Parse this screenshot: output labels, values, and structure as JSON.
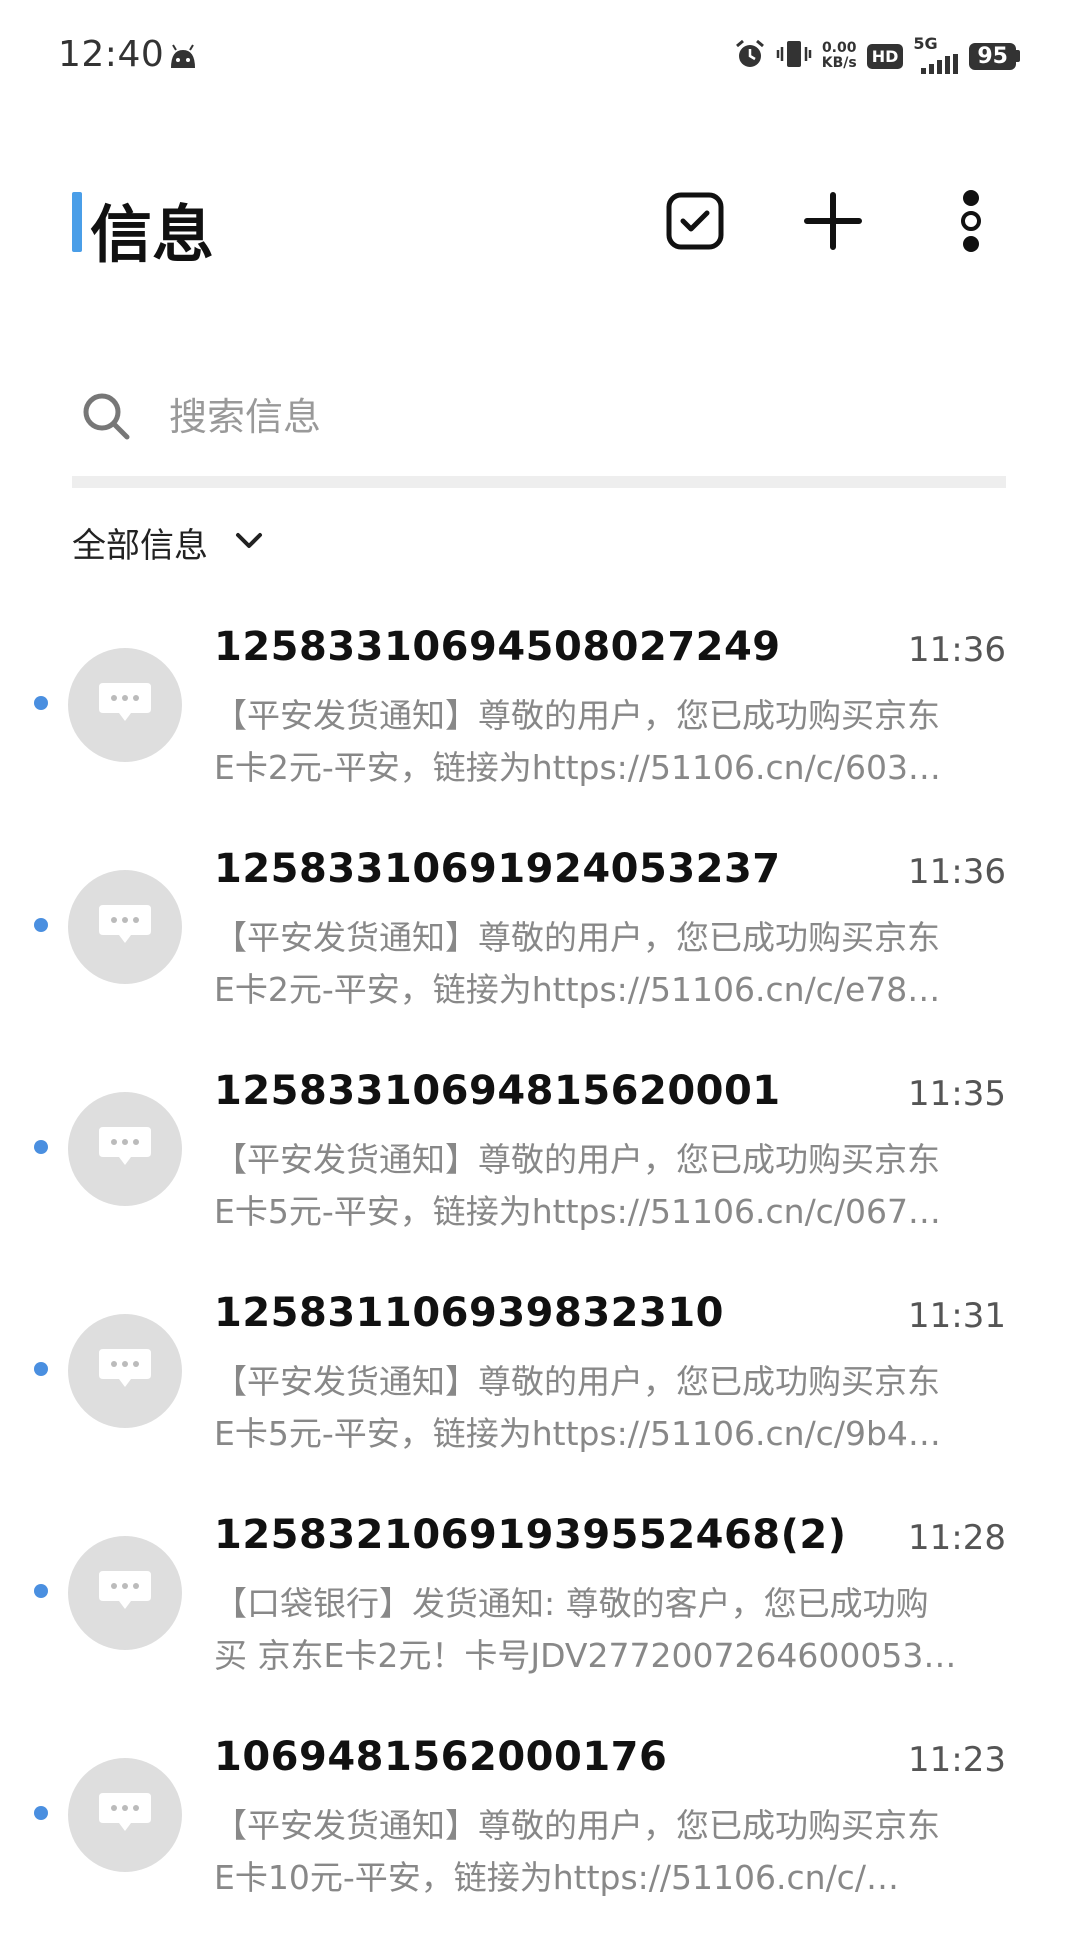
{
  "status_bar": {
    "time": "12:40",
    "netspeed_value": "0.00",
    "netspeed_unit": "KB/s",
    "hd": "HD",
    "network": "5G",
    "battery": "95"
  },
  "header": {
    "title": "信息"
  },
  "search": {
    "placeholder": "搜索信息"
  },
  "filter": {
    "label": "全部信息"
  },
  "messages": [
    {
      "sender": "125833106945080272​49",
      "time": "11:36",
      "line1": "【平安发货通知】尊敬的用户，您已成功购买京东",
      "line2": "E卡2元-平安，链接为https://51106.cn/c/603…"
    },
    {
      "sender": "1258331069192405323​7",
      "time": "11:36",
      "line1": "【平安发货通知】尊敬的用户，您已成功购买京东",
      "line2": "E卡2元-平安，链接为https://51106.cn/c/e78…"
    },
    {
      "sender": "1258331069481562000​1",
      "time": "11:35",
      "line1": "【平安发货通知】尊敬的用户，您已成功购买京东",
      "line2": "E卡5元-平安，链接为https://51106.cn/c/067…"
    },
    {
      "sender": "12583110693983231​0",
      "time": "11:31",
      "line1": "【平安发货通知】尊敬的用户，您已成功购买京东",
      "line2": "E卡5元-平安，链接为https://51106.cn/c/9b4…"
    },
    {
      "sender": "1258321069193955246​8(2)",
      "time": "11:28",
      "line1": "【口袋银行】发货通知: 尊敬的客户，您已成功购",
      "line2": "买 京东E卡2元！卡号JDV2772007264600053…"
    },
    {
      "sender": "1069481562000176",
      "time": "11:23",
      "line1": "【平安发货通知】尊敬的用户，您已成功购买京东",
      "line2": "E卡10元-平安，链接为https://51106.cn/c/…"
    }
  ]
}
